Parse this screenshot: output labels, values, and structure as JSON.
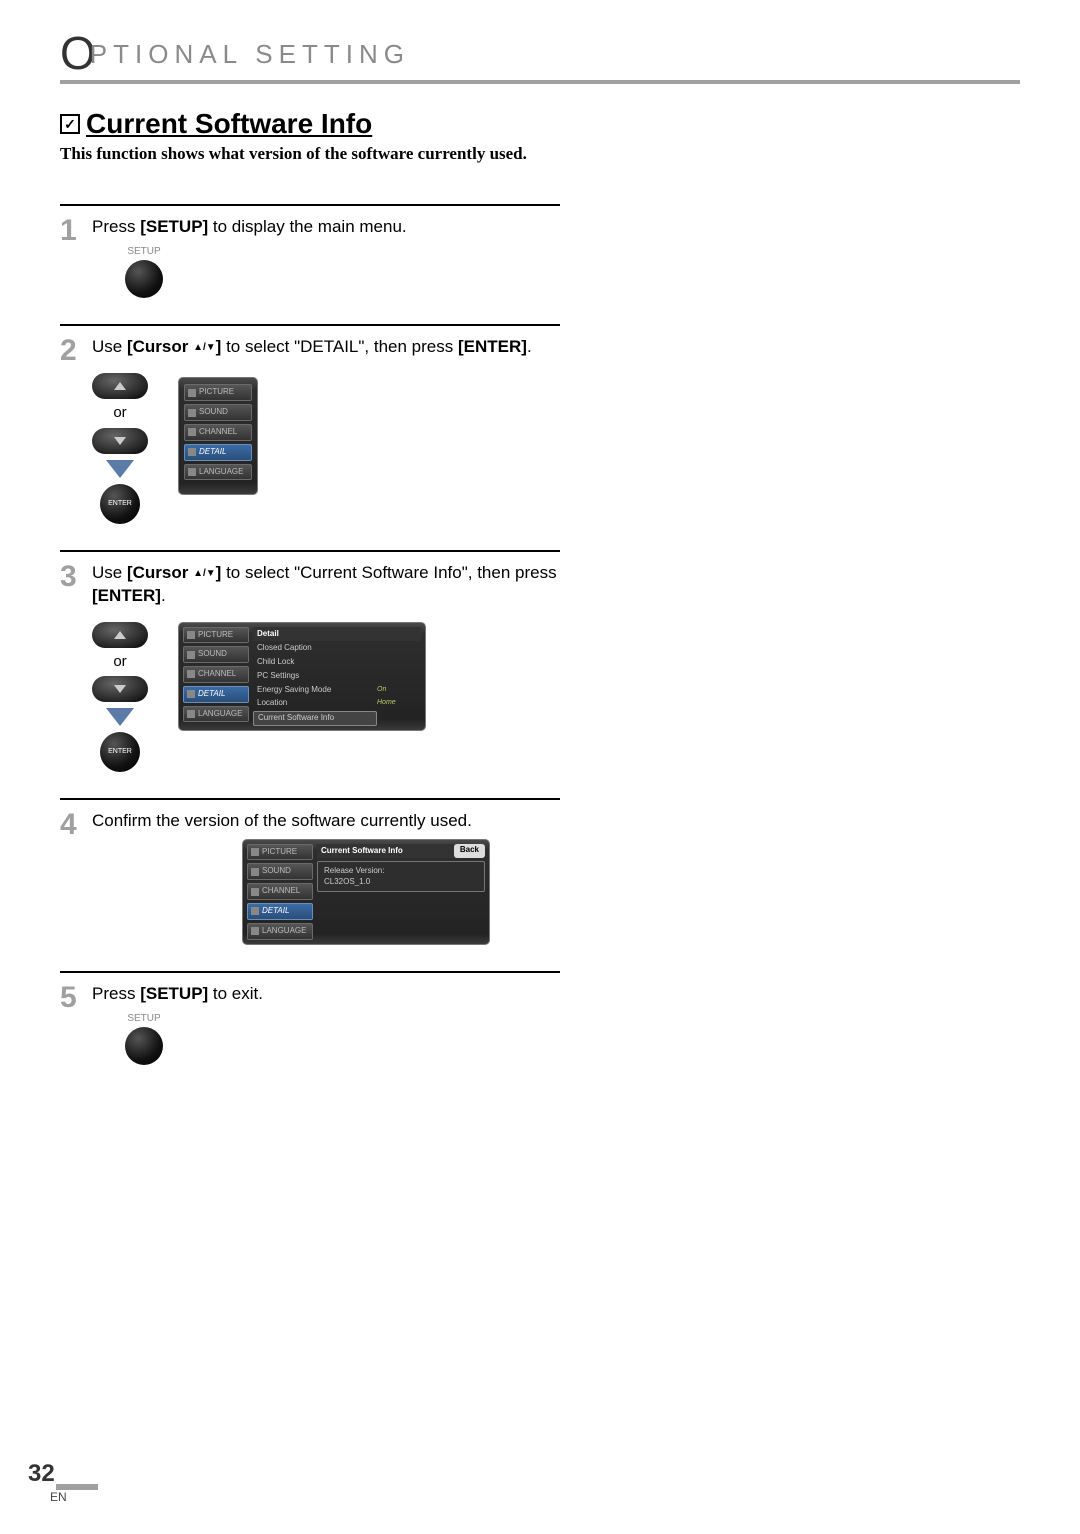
{
  "header": {
    "big_o": "O",
    "rest": "PTIONAL  SETTING"
  },
  "section": {
    "check": "✓",
    "title": "Current Software Info",
    "subtitle": "This function shows what version of the software currently used."
  },
  "steps": {
    "s1": {
      "num": "1",
      "pre": "Press ",
      "bold": "[SETUP]",
      "post": " to display the main menu.",
      "setup_label": "SETUP"
    },
    "s2": {
      "num": "2",
      "pre": "Use ",
      "bold1": "[Cursor ",
      "arrows": "▲/▼",
      "bold1b": "]",
      "mid": " to select \"DETAIL\", then press ",
      "bold2": "[ENTER]",
      "post": ".",
      "or": "or",
      "enter": "ENTER",
      "menu": {
        "picture": "PICTURE",
        "sound": "SOUND",
        "channel": "CHANNEL",
        "detail": "DETAIL",
        "language": "LANGUAGE"
      }
    },
    "s3": {
      "num": "3",
      "pre": "Use ",
      "bold1": "[Cursor ",
      "arrows": "▲/▼",
      "bold1b": "]",
      "mid": " to select \"Current Software Info\", then press ",
      "bold2": "[ENTER]",
      "post": ".",
      "or": "or",
      "enter": "ENTER",
      "side": {
        "picture": "PICTURE",
        "sound": "SOUND",
        "channel": "CHANNEL",
        "detail": "DETAIL",
        "language": "LANGUAGE"
      },
      "panel": {
        "head": "Detail",
        "r1": "Closed Caption",
        "r2": "Child Lock",
        "r3": "PC Settings",
        "r4": "Energy Saving Mode",
        "v4": "On",
        "r5": "Location",
        "v5": "Home",
        "r6": "Current Software Info"
      }
    },
    "s4": {
      "num": "4",
      "text": "Confirm the version of the software currently used.",
      "side": {
        "picture": "PICTURE",
        "sound": "SOUND",
        "channel": "CHANNEL",
        "detail": "DETAIL",
        "language": "LANGUAGE"
      },
      "panel": {
        "head": "Current Software Info",
        "back": "Back",
        "rel_label": "Release Version:",
        "rel_value": "CL32OS_1.0"
      }
    },
    "s5": {
      "num": "5",
      "pre": "Press ",
      "bold": "[SETUP]",
      "post": " to exit.",
      "setup_label": "SETUP"
    }
  },
  "footer": {
    "page": "32",
    "lang": "EN"
  }
}
